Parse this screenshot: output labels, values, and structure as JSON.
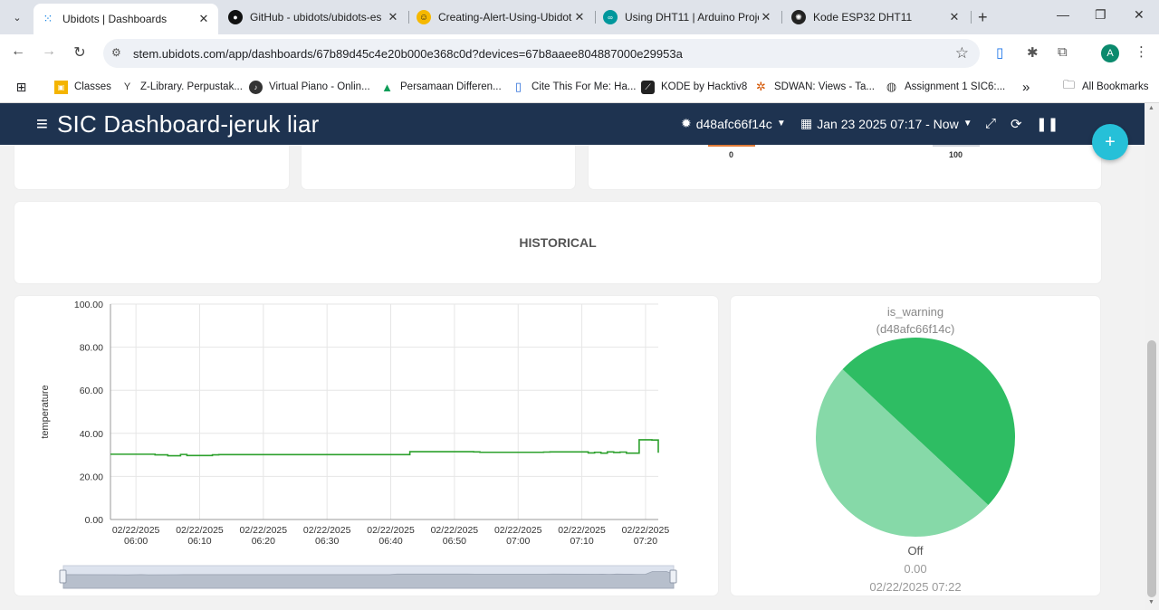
{
  "browser": {
    "tabs": [
      {
        "title": "Ubidots | Dashboards",
        "active": true
      },
      {
        "title": "GitHub - ubidots/ubidots-es"
      },
      {
        "title": "Creating-Alert-Using-Ubidot"
      },
      {
        "title": "Using DHT11 | Arduino Proje"
      },
      {
        "title": "Kode ESP32 DHT11"
      }
    ],
    "url": "stem.ubidots.com/app/dashboards/67b89d45c4e20b000e368c0d?devices=67b8aaee804887000e29953a",
    "avatar_letter": "A",
    "bookmarks": [
      "Classes",
      "Z-Library. Perpustak...",
      "Virtual Piano - Onlin...",
      "Persamaan Differen...",
      "Cite This For Me: Ha...",
      "KODE by Hacktiv8",
      "SDWAN: Views - Ta...",
      "Assignment 1 SIC6:..."
    ],
    "more_label": "»",
    "all_bookmarks": "All Bookmarks"
  },
  "app": {
    "title": "SIC Dashboard-jeruk liar",
    "device": "d48afc66f14c",
    "date_range": "Jan 23 2025 07:17 - Now",
    "colors": {
      "header": "#1e3350",
      "fab": "#26c0d8",
      "line": "#2ca02c",
      "pie_on": "#2ebd63",
      "pie_off": "#86d9a8"
    }
  },
  "gauge": {
    "min_label": "0",
    "max_label": "100"
  },
  "historical": {
    "title": "HISTORICAL"
  },
  "chart_data": {
    "type": "line",
    "title": "",
    "xlabel": "",
    "ylabel": "temperature",
    "ylim": [
      0,
      100
    ],
    "yticks": [
      "0.00",
      "20.00",
      "40.00",
      "60.00",
      "80.00",
      "100.00"
    ],
    "xticks": [
      [
        "02/22/2025",
        "06:00"
      ],
      [
        "02/22/2025",
        "06:10"
      ],
      [
        "02/22/2025",
        "06:20"
      ],
      [
        "02/22/2025",
        "06:30"
      ],
      [
        "02/22/2025",
        "06:40"
      ],
      [
        "02/22/2025",
        "06:50"
      ],
      [
        "02/22/2025",
        "07:00"
      ],
      [
        "02/22/2025",
        "07:10"
      ],
      [
        "02/22/2025",
        "07:20"
      ]
    ],
    "xlim": [
      "05:56",
      "07:22"
    ],
    "series": [
      {
        "x": [
          "05:56",
          "06:03",
          "06:05",
          "06:07",
          "06:08",
          "06:12",
          "06:13",
          "06:42",
          "06:43",
          "06:53",
          "06:54",
          "07:04",
          "07:05",
          "07:11",
          "07:12",
          "07:13",
          "07:14",
          "07:15",
          "07:16",
          "07:17",
          "07:18",
          "07:19",
          "07:20",
          "07:21",
          "07:22"
        ],
        "values": [
          30.3,
          30.0,
          29.6,
          30.2,
          29.7,
          30.0,
          30.1,
          30.1,
          31.5,
          31.4,
          31.2,
          31.3,
          31.4,
          30.9,
          31.2,
          30.8,
          31.4,
          31.1,
          31.3,
          30.8,
          30.8,
          37.0,
          37.0,
          36.9,
          31.0
        ]
      }
    ],
    "grid": true
  },
  "pie": {
    "title": "is_warning",
    "subtitle": "(d48afc66f14c)",
    "state": "Off",
    "value": "0.00",
    "timestamp": "02/22/2025 07:22",
    "slices": [
      50,
      50
    ]
  }
}
